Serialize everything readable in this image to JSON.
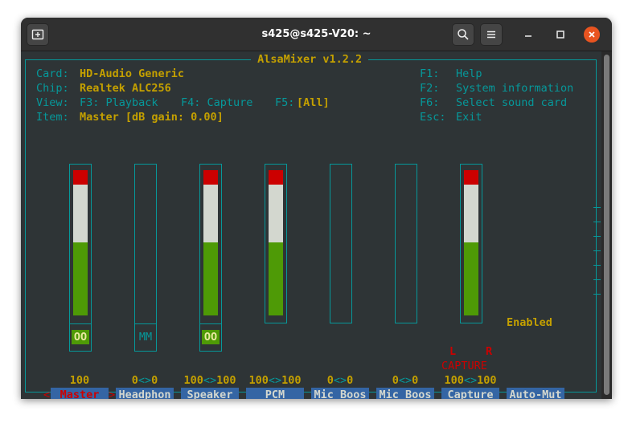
{
  "window": {
    "title": "s425@s425-V20: ~"
  },
  "icons": {
    "new_tab": "new-tab-icon",
    "search": "search-icon",
    "menu": "hamburger-menu-icon",
    "minimize": "minimize-icon",
    "maximize": "maximize-icon",
    "close": "close-icon"
  },
  "alsamixer": {
    "title": " AlsaMixer v1.2.2 ",
    "info": {
      "card_label": "Card:",
      "card_value": "HD-Audio Generic",
      "chip_label": "Chip:",
      "chip_value": "Realtek ALC256",
      "view_label": "View:",
      "view_f3": "F3: Playback",
      "view_f4": "F4: Capture",
      "view_f5": "F5:",
      "view_all": "[All]",
      "item_label": "Item:",
      "item_value": "Master [dB gain: 0.00]"
    },
    "help": [
      {
        "key": "F1:",
        "text": "Help"
      },
      {
        "key": "F2:",
        "text": "System information"
      },
      {
        "key": "F6:",
        "text": "Select sound card"
      },
      {
        "key": "Esc:",
        "text": "Exit"
      }
    ],
    "enabled_label": "Enabled",
    "capture_lr": {
      "left": "L",
      "right": "R"
    },
    "capture_label": "CAPTURE",
    "selected_marker_left": "<",
    "selected_marker_right": ">",
    "channels": [
      {
        "name": "Master",
        "selected": true,
        "value_left": "100",
        "sep": "",
        "value_right": "",
        "level": 1.0,
        "badge": "OO",
        "has_meter": true
      },
      {
        "name": "Headphon",
        "selected": false,
        "value_left": "0",
        "sep": "<>",
        "value_right": "0",
        "level": 0.0,
        "badge": "MM",
        "has_meter": true
      },
      {
        "name": "Speaker",
        "selected": false,
        "value_left": "100",
        "sep": "<>",
        "value_right": "100",
        "level": 1.0,
        "badge": "OO",
        "has_meter": true
      },
      {
        "name": "PCM",
        "selected": false,
        "value_left": "100",
        "sep": "<>",
        "value_right": "100",
        "level": 1.0,
        "badge": "",
        "has_meter": true
      },
      {
        "name": "Mic Boos",
        "selected": false,
        "value_left": "0",
        "sep": "<>",
        "value_right": "0",
        "level": 0.0,
        "badge": "",
        "has_meter": true
      },
      {
        "name": "Mic Boos",
        "selected": false,
        "value_left": "0",
        "sep": "<>",
        "value_right": "0",
        "level": 0.0,
        "badge": "",
        "has_meter": true
      },
      {
        "name": "Capture",
        "selected": false,
        "value_left": "100",
        "sep": "<>",
        "value_right": "100",
        "level": 1.0,
        "badge": "",
        "has_meter": true
      },
      {
        "name": "Auto-Mut",
        "selected": false,
        "value_left": "",
        "sep": "",
        "value_right": "",
        "level": 0.0,
        "badge": "",
        "has_meter": false
      }
    ]
  },
  "colors": {
    "terminal_bg": "#2e3436",
    "cyan": "#06989a",
    "yellow": "#c4a000",
    "red": "#cc0000",
    "green": "#4e9a06",
    "white": "#d3d7cf",
    "blue": "#3465a4"
  }
}
